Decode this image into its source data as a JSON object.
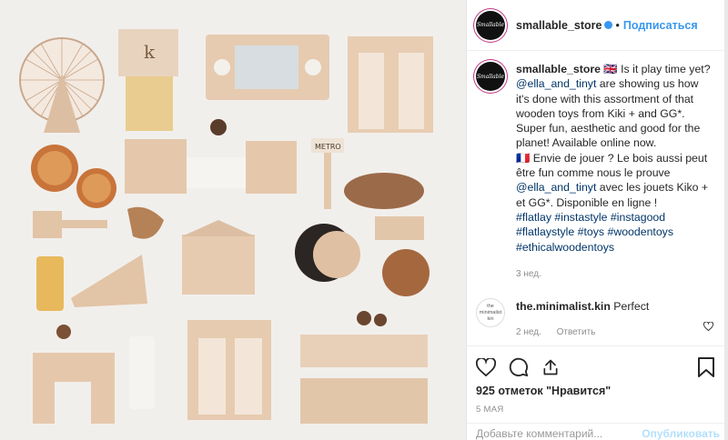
{
  "post": {
    "username": "smallable_store",
    "avatar_text": "Smallable",
    "follow_label": "Подписаться",
    "separator": "•",
    "caption": {
      "flag_uk": "🇬🇧",
      "line1": "Is it play time yet?",
      "mention1": "@ella_and_tinyt",
      "line2": "are showing us how it's done with this assortment of that wooden toys from Kiki + and GG*. Super fun, aesthetic and good for the planet! Available online now.",
      "flag_fr": "🇫🇷",
      "line3": "Envie de jouer ? Le bois aussi peut être fun comme nous le prouve",
      "mention2": "@ella_and_tinyt",
      "line4": "avec les jouets Kiko + et GG*. Disponible en ligne !",
      "hashtags": [
        "#flatlay",
        "#instastyle",
        "#instagood",
        "#flatlaystyle",
        "#toys",
        "#woodentoys",
        "#ethicalwoodentoys"
      ],
      "time": "3 нед."
    },
    "comment": {
      "avatar_text": "the minimalist kin",
      "username": "the.minimalist.kin",
      "text": "Perfect",
      "time": "2 нед.",
      "reply_label": "Ответить"
    },
    "likes": "925 отметок \"Нравится\"",
    "date": "5 МАЯ",
    "add_comment_placeholder": "Добавьте комментарий...",
    "publish_label": "Опубликовать",
    "photo_sign_metro": "METRO"
  },
  "colors": {
    "link": "#003569",
    "follow": "#3897f0",
    "muted": "#8e8e8e",
    "photo_bg": "#f1efec",
    "wood": "#e2c4a6",
    "orange": "#c8743a"
  },
  "icons": [
    "heart-icon",
    "comment-icon",
    "share-icon",
    "bookmark-icon",
    "verified-icon"
  ]
}
